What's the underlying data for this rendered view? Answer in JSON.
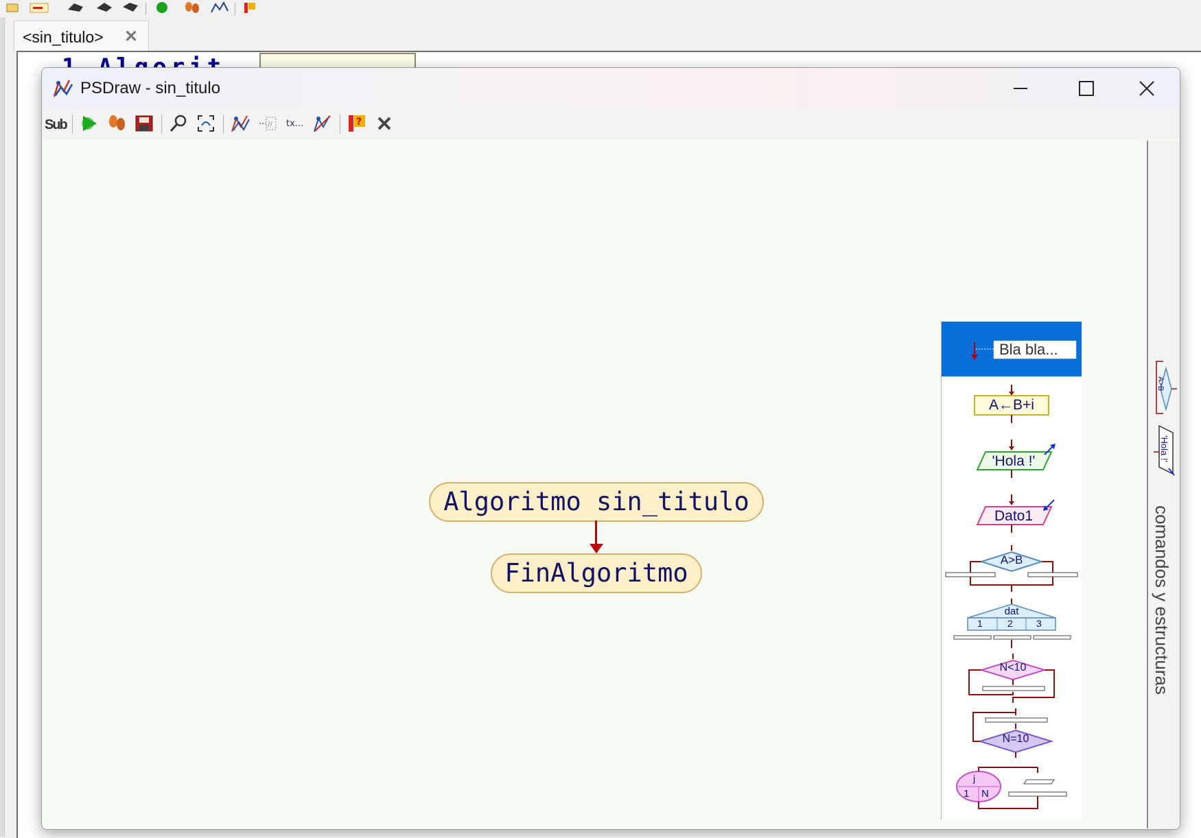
{
  "ide": {
    "tab_label": "<sin_titulo>",
    "tab_close": "✕",
    "code_fragment": "1 Algorit"
  },
  "window": {
    "title": "PSDraw - sin_titulo",
    "minimize": "—",
    "maximize": "☐",
    "close": "✕"
  },
  "toolbar": {
    "sub_label": "Sub"
  },
  "flowchart": {
    "start_node": "Algoritmo sin_titulo",
    "end_node": "FinAlgoritmo"
  },
  "palette": {
    "items": [
      {
        "name": "comment",
        "text": "Bla bla..."
      },
      {
        "name": "assign",
        "text": "A←B+i"
      },
      {
        "name": "write",
        "text": "'Hola !'"
      },
      {
        "name": "read",
        "text": "Dato1"
      },
      {
        "name": "if",
        "text": "A>B"
      },
      {
        "name": "switch",
        "text": "dat",
        "options": [
          "1",
          "2",
          "3"
        ]
      },
      {
        "name": "while",
        "text": "N<10"
      },
      {
        "name": "repeat",
        "text": "N=10"
      },
      {
        "name": "for",
        "text": "j",
        "range": [
          "1",
          "N"
        ]
      }
    ]
  },
  "side_panel": {
    "label": "comandos y estructuras",
    "mini_if": "A>B",
    "mini_write": "'Hola !'"
  },
  "colors": {
    "canvas": "#f6fcf4",
    "node_fill": "#fdf0c8",
    "node_border": "#d4b070",
    "node_text": "#111166",
    "arrow": "#c00000",
    "palette_selected": "#0a6fd8"
  }
}
